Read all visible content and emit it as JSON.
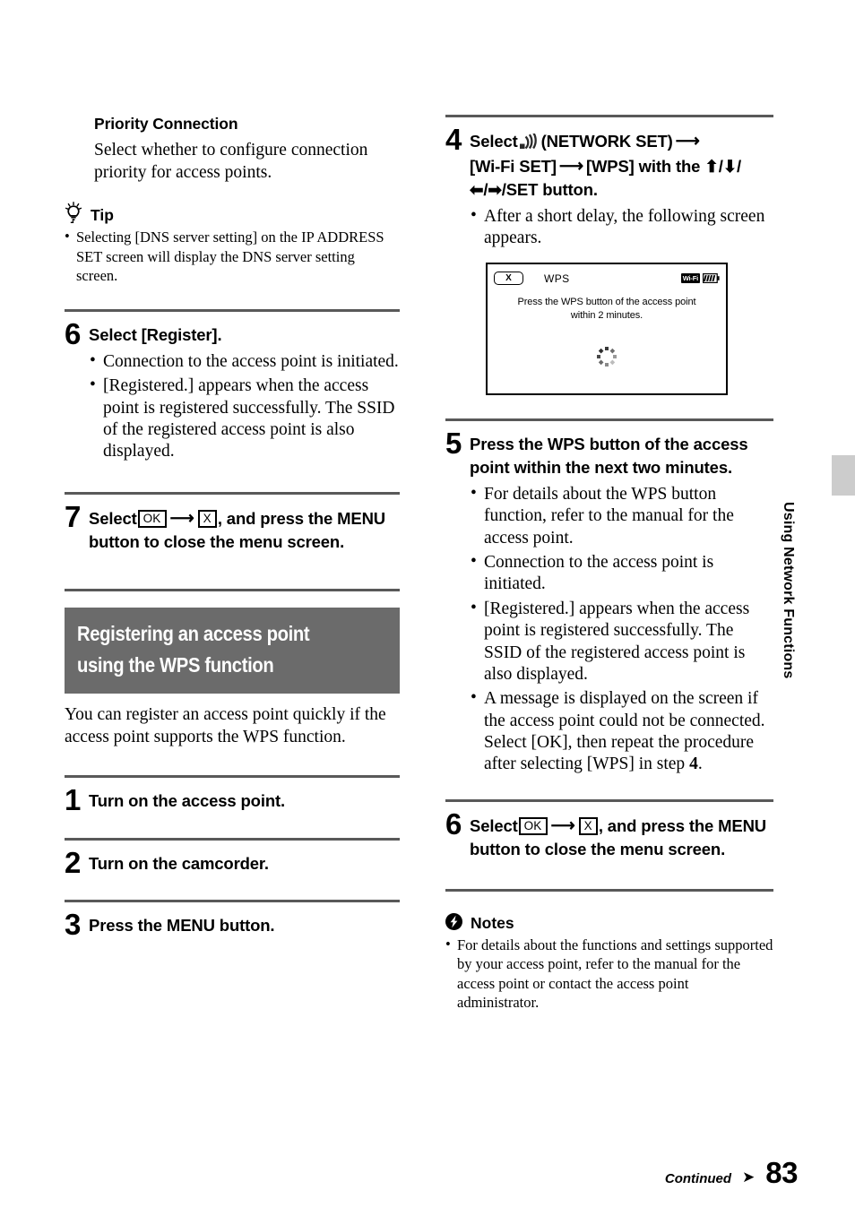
{
  "page": {
    "number": "83",
    "continued_label": "Continued",
    "side_tab_label": "Using Network Functions",
    "band_color": "#6b6b6b",
    "rule_color": "#595959",
    "tab_color": "#cccccc"
  },
  "left": {
    "priority": {
      "heading": "Priority Connection",
      "body": "Select whether to configure connection priority for access points."
    },
    "tip": {
      "icon": "lightbulb-icon",
      "label": "Tip",
      "items": [
        "Selecting [DNS server setting] on the IP ADDRESS SET screen will display the DNS server setting screen."
      ]
    },
    "step6": {
      "num": "6",
      "title": "Select [Register].",
      "bullets": [
        "Connection to the access point is initiated.",
        "[Registered.] appears when the access point is registered successfully. The SSID of the registered access point is also displayed."
      ]
    },
    "step7": {
      "num": "7",
      "title_pre": "Select",
      "key_ok": "OK",
      "key_x": "X",
      "title_post": ", and press the MENU button to close the menu screen."
    },
    "band": {
      "line1": "Registering an access point",
      "line2": "using the WPS function",
      "intro": "You can register an access point quickly if the access point supports the WPS function."
    },
    "step1": {
      "num": "1",
      "title": "Turn on the access point."
    },
    "step2": {
      "num": "2",
      "title": "Turn on the camcorder."
    },
    "step3": {
      "num": "3",
      "title": "Press the MENU button."
    }
  },
  "right": {
    "step4": {
      "num": "4",
      "title_pre": "Select",
      "network_icon": "network-wifi-icon",
      "title_post": "(NETWORK SET)",
      "title_line2_a": "[Wi-Fi SET]",
      "title_line2_b": "[WPS] with the",
      "buttons": "/ / / /SET button.",
      "up_arrow": "⬆",
      "down_arrow": "⬇",
      "left_arrow": "⬅",
      "right_arrow": "➡",
      "bullets": [
        "After a short delay, the following screen appears."
      ]
    },
    "lcd": {
      "close_label": "X",
      "title": "WPS",
      "badge_wifi": "Wi-Fi",
      "badge_battery": "battery-icon",
      "message_line1": "Press the WPS button of the access point",
      "message_line2": "within 2 minutes.",
      "spinner": "loading-spinner-icon"
    },
    "step5": {
      "num": "5",
      "title": "Press the WPS button of the access point within the next two minutes.",
      "bullets": [
        "For details about the WPS button function, refer to the manual for the access point.",
        "Connection to the access point is initiated.",
        "[Registered.] appears when the access point is registered successfully. The SSID of the registered access point is also displayed.",
        "A message is displayed on the screen if the access point could not be connected. Select [OK], then repeat the procedure after selecting [WPS] in step 4."
      ],
      "bullet4_pre": "A message is displayed on the screen if the access point could not be connected. Select [OK], then repeat the procedure after selecting [WPS] in step ",
      "bullet4_step": "4",
      "bullet4_post": "."
    },
    "step6": {
      "num": "6",
      "title_pre": "Select",
      "key_ok": "OK",
      "key_x": "X",
      "title_post": ", and press the MENU button to close the menu screen."
    },
    "notes": {
      "icon": "flash-note-icon",
      "label": "Notes",
      "items": [
        "For details about the functions and settings supported by your access point, refer to the manual for the access point or contact the access point administrator."
      ]
    }
  }
}
